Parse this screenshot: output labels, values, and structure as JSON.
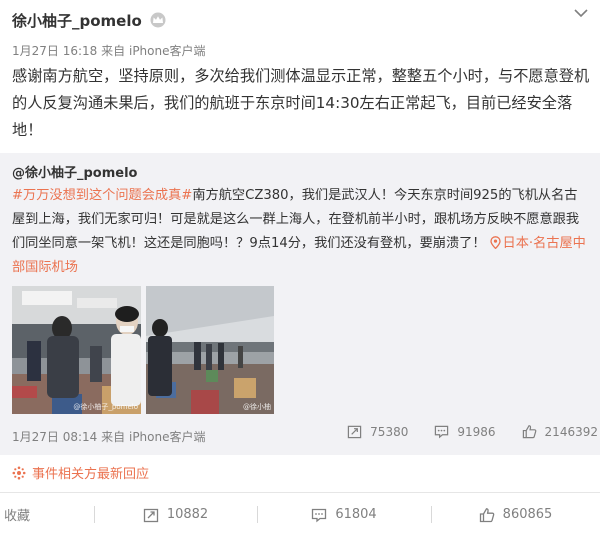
{
  "post": {
    "username": "徐小柚子_pomelo",
    "timestamp": "1月27日 16:18",
    "source_prefix": "来自",
    "source_app": "iPhone客户端",
    "text": "感谢南方航空，坚持原则，多次给我们测体温显示正常，整整五个小时，与不愿意登机的人反复沟通未果后，我们的航班于东京时间14:30左右正常起飞，目前已经安全落地！"
  },
  "quoted": {
    "author": "@徐小柚子_pomelo",
    "hashtag": "#万万没想到这个问题会成真#",
    "text": "南方航空CZ380，我们是武汉人！今天东京时间925的飞机从名古屋到上海，我们无家可归！可是就是这么一群上海人，在登机前半小时，跟机场方反映不愿意跟我们同坐同意一架飞机！这还是同胞吗！？9点14分，我们还没有登机，要崩溃了！",
    "location": "日本·名古屋中部国际机场",
    "photo_watermarks": [
      "@徐小柚子_pomelo",
      "@徐小柚"
    ],
    "timestamp": "1月27日 08:14",
    "source_prefix": "来自",
    "source_app": "iPhone客户端",
    "reposts": "75380",
    "comments": "91986",
    "likes": "2146392"
  },
  "event_link": "事件相关方最新回应",
  "actions": {
    "favorite": "收藏",
    "reposts": "10882",
    "comments": "61804",
    "likes": "860865"
  },
  "colors": {
    "accent": "#eb7350",
    "meta": "#808080",
    "quote_bg": "#f2f2f5"
  },
  "icons": {
    "vip": "crown-icon",
    "menu": "chevron-down-icon",
    "location": "location-pin-icon",
    "repost": "repost-icon",
    "comment": "comment-icon",
    "like": "thumbs-up-icon",
    "event": "event-icon"
  }
}
